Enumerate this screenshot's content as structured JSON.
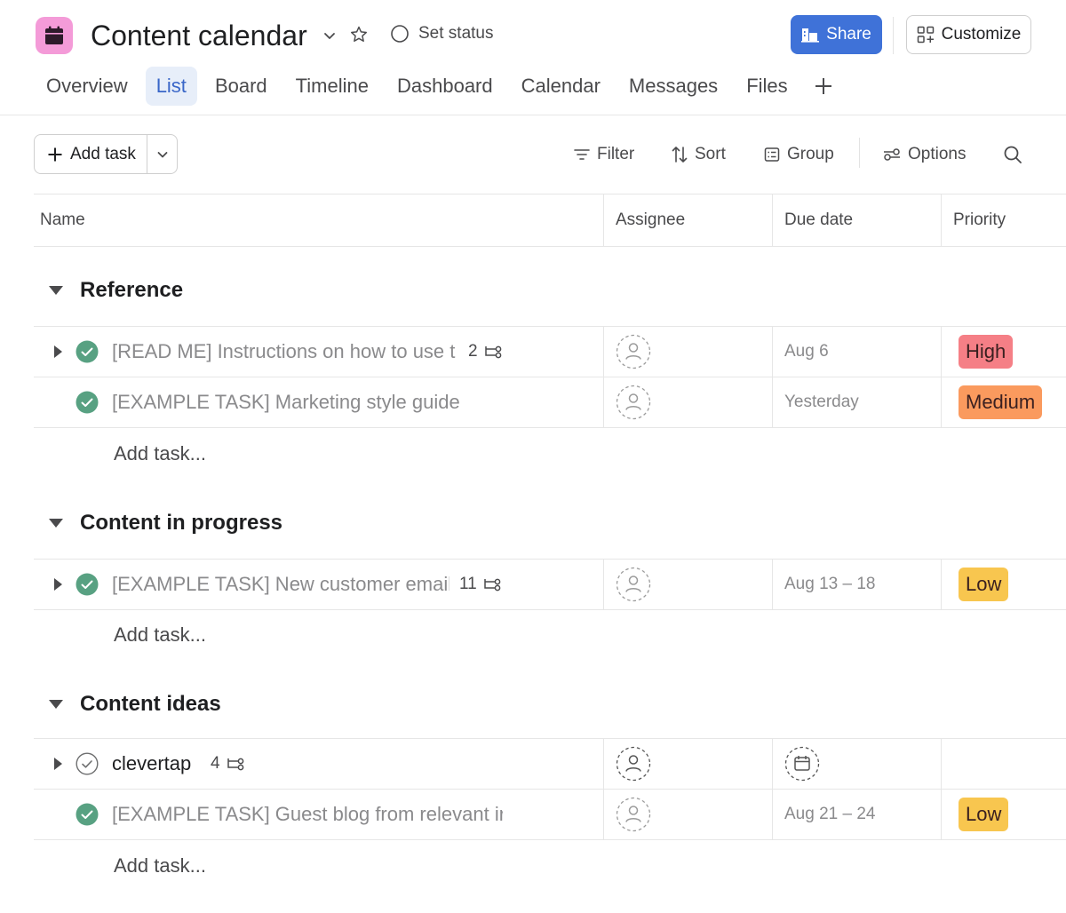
{
  "header": {
    "title": "Content calendar",
    "set_status": "Set status",
    "share_label": "Share",
    "customize_label": "Customize",
    "project_color": "#f49bd8",
    "share_color": "#3f72d8"
  },
  "tabs": [
    {
      "label": "Overview",
      "active": false
    },
    {
      "label": "List",
      "active": true
    },
    {
      "label": "Board",
      "active": false
    },
    {
      "label": "Timeline",
      "active": false
    },
    {
      "label": "Dashboard",
      "active": false
    },
    {
      "label": "Calendar",
      "active": false
    },
    {
      "label": "Messages",
      "active": false
    },
    {
      "label": "Files",
      "active": false
    }
  ],
  "toolbar": {
    "add_task": "Add task",
    "filter": "Filter",
    "sort": "Sort",
    "group": "Group",
    "options": "Options"
  },
  "columns": {
    "name": "Name",
    "assignee": "Assignee",
    "due": "Due date",
    "priority": "Priority"
  },
  "priority_colors": {
    "High": "#f57f86",
    "Medium": "#fa9a5e",
    "Low": "#f8c64f"
  },
  "add_task_row": "Add task...",
  "sections": [
    {
      "title": "Reference",
      "tasks": [
        {
          "name": "[READ ME] Instructions on how to use t",
          "completed": true,
          "subtasks": "2",
          "due": "Aug 6",
          "priority": "High",
          "expandable": true
        },
        {
          "name": "[EXAMPLE TASK] Marketing style guide",
          "completed": true,
          "subtasks": "",
          "due": "Yesterday",
          "priority": "Medium",
          "expandable": false
        }
      ]
    },
    {
      "title": "Content in progress",
      "tasks": [
        {
          "name": "[EXAMPLE TASK] New customer email",
          "completed": true,
          "subtasks": "11",
          "due": "Aug 13 – 18",
          "priority": "Low",
          "expandable": true
        }
      ]
    },
    {
      "title": "Content ideas",
      "tasks": [
        {
          "name": "clevertap",
          "completed": false,
          "subtasks": "4",
          "due": "",
          "priority": "",
          "expandable": true
        },
        {
          "name": "[EXAMPLE TASK] Guest blog from relevant ir",
          "completed": true,
          "subtasks": "",
          "due": "Aug 21 – 24",
          "priority": "Low",
          "expandable": false
        }
      ]
    }
  ]
}
